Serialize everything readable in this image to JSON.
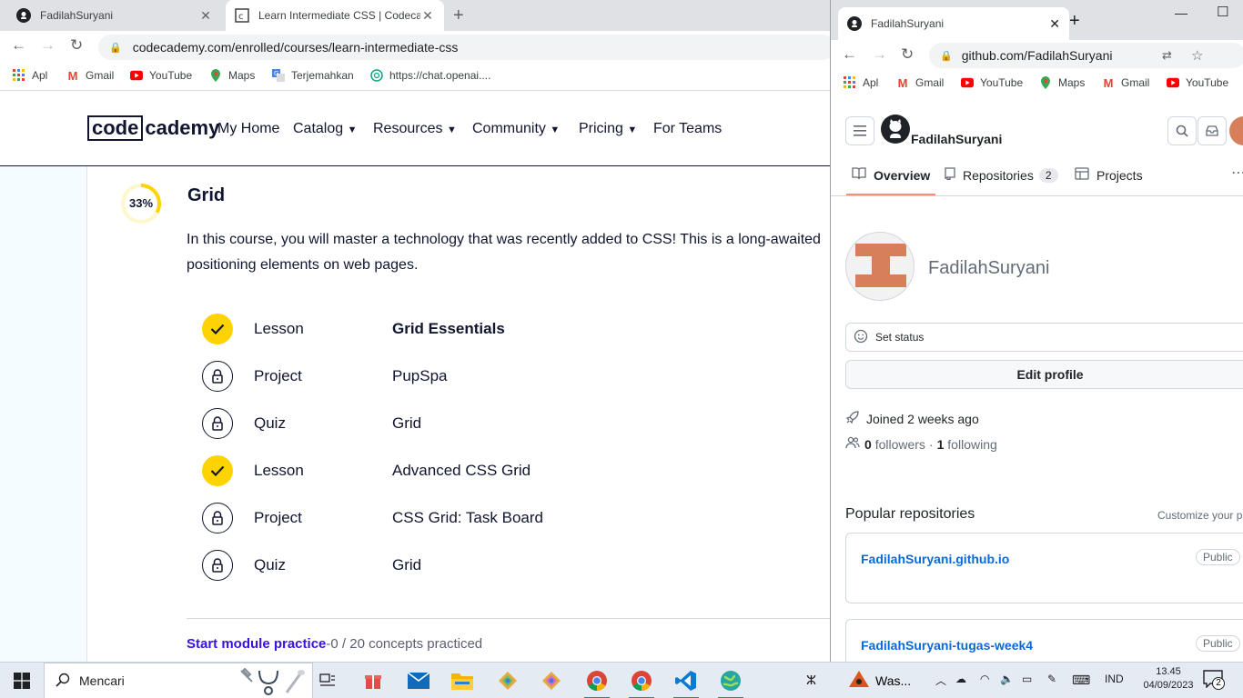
{
  "left_browser": {
    "tabs": [
      {
        "title": "FadilahSuryani",
        "active": false
      },
      {
        "title": "Learn Intermediate CSS | Codecademy",
        "active": true
      }
    ],
    "url": "codecademy.com/enrolled/courses/learn-intermediate-css",
    "bookmarks": [
      "Apl",
      "Gmail",
      "YouTube",
      "Maps",
      "Terjemahkan",
      "https://chat.openai...."
    ]
  },
  "codecademy": {
    "logo_box": "code",
    "logo_rest": "cademy",
    "nav": [
      "My Home",
      "Catalog",
      "Resources",
      "Community",
      "Pricing",
      "For Teams"
    ],
    "module": {
      "progress_label": "33%",
      "progress_fraction": 0.33,
      "title": "Grid",
      "description_line1": "In this course, you will master a technology that was recently added to CSS! This is a long-awaited",
      "description_line2": "positioning elements on web pages.",
      "items": [
        {
          "type": "Lesson",
          "name": "Grid Essentials",
          "status": "done"
        },
        {
          "type": "Project",
          "name": "PupSpa",
          "status": "locked"
        },
        {
          "type": "Quiz",
          "name": "Grid",
          "status": "locked"
        },
        {
          "type": "Lesson",
          "name": "Advanced CSS Grid",
          "status": "done"
        },
        {
          "type": "Project",
          "name": "CSS Grid: Task Board",
          "status": "locked"
        },
        {
          "type": "Quiz",
          "name": "Grid",
          "status": "locked"
        }
      ],
      "practice_link": "Start module practice",
      "practice_count": "-0 / 20 concepts practiced"
    }
  },
  "right_browser": {
    "tab_title": "FadilahSuryani",
    "url": "github.com/FadilahSuryani",
    "bookmarks": [
      "Apl",
      "Gmail",
      "YouTube",
      "Maps",
      "Gmail",
      "YouTube"
    ]
  },
  "github": {
    "username_header": "FadilahSuryani",
    "tabs": [
      {
        "label": "Overview",
        "count": ""
      },
      {
        "label": "Repositories",
        "count": "2"
      },
      {
        "label": "Projects",
        "count": ""
      }
    ],
    "display_name": "FadilahSuryani",
    "set_status": "Set status",
    "edit_profile": "Edit profile",
    "joined": "Joined 2 weeks ago",
    "followers_count": "0",
    "followers_label": "followers",
    "separator": "·",
    "following_count": "1",
    "following_label": "following",
    "popular_title": "Popular repositories",
    "customize": "Customize your pins",
    "repos": [
      {
        "name": "FadilahSuryani.github.io",
        "visibility": "Public"
      },
      {
        "name": "FadilahSuryani-tugas-week4",
        "visibility": "Public"
      }
    ]
  },
  "taskbar": {
    "search_placeholder": "Mencari",
    "notification": "Was...",
    "language": "IND",
    "time": "13.45",
    "date": "04/09/2023",
    "notification_count": "2"
  },
  "colors": {
    "codecademy_navy": "#10162f",
    "codecademy_yellow": "#ffd300",
    "github_link": "#0969da",
    "github_tab_accent": "#fd8c73"
  }
}
